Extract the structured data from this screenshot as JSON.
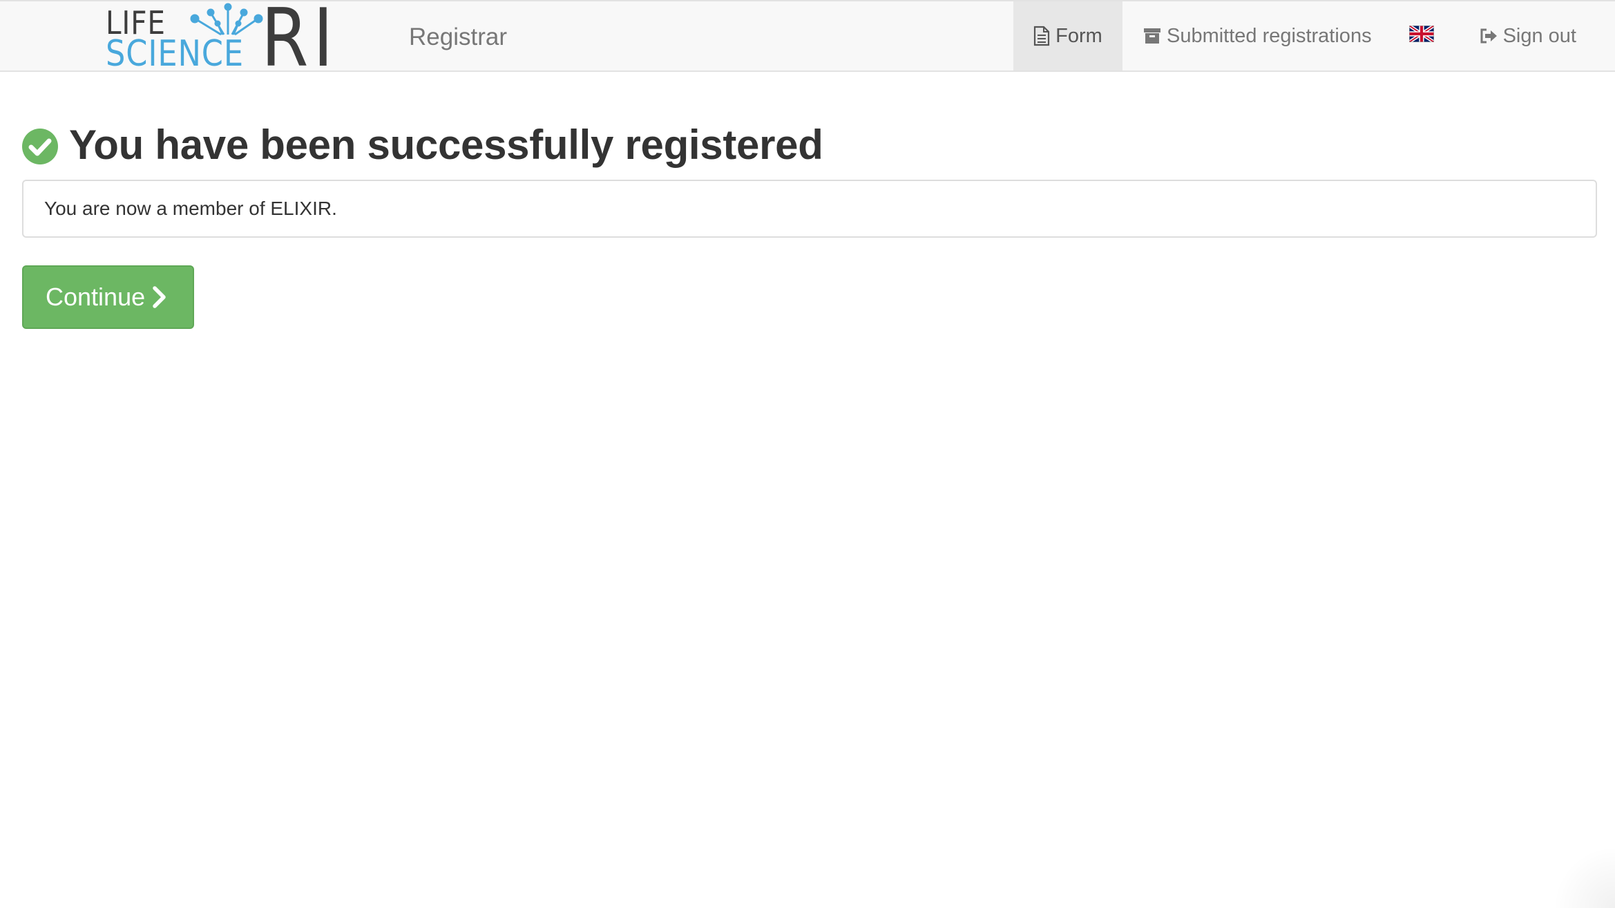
{
  "navbar": {
    "logo": {
      "line1": "LIFE",
      "line2": "SCIENCE",
      "mark": "RI",
      "icon": "spark-burst-icon"
    },
    "app_title": "Registrar",
    "items": [
      {
        "label": "Form",
        "icon": "file-text-icon",
        "active": true
      },
      {
        "label": "Submitted registrations",
        "icon": "archive-box-icon",
        "active": false
      },
      {
        "label": "",
        "icon": "uk-flag-icon",
        "active": false
      },
      {
        "label": "Sign out",
        "icon": "sign-out-icon",
        "active": false
      }
    ]
  },
  "main": {
    "heading": "You have been successfully registered",
    "heading_icon": "check-circle-icon",
    "message": "You are now a member of ELIXIR.",
    "continue_label": "Continue",
    "continue_icon": "chevron-right-icon"
  },
  "colors": {
    "success_green": "#6cb763",
    "logo_blue": "#49a8dc",
    "navbar_bg": "#f8f8f8",
    "active_tab_bg": "#e7e7e7"
  }
}
